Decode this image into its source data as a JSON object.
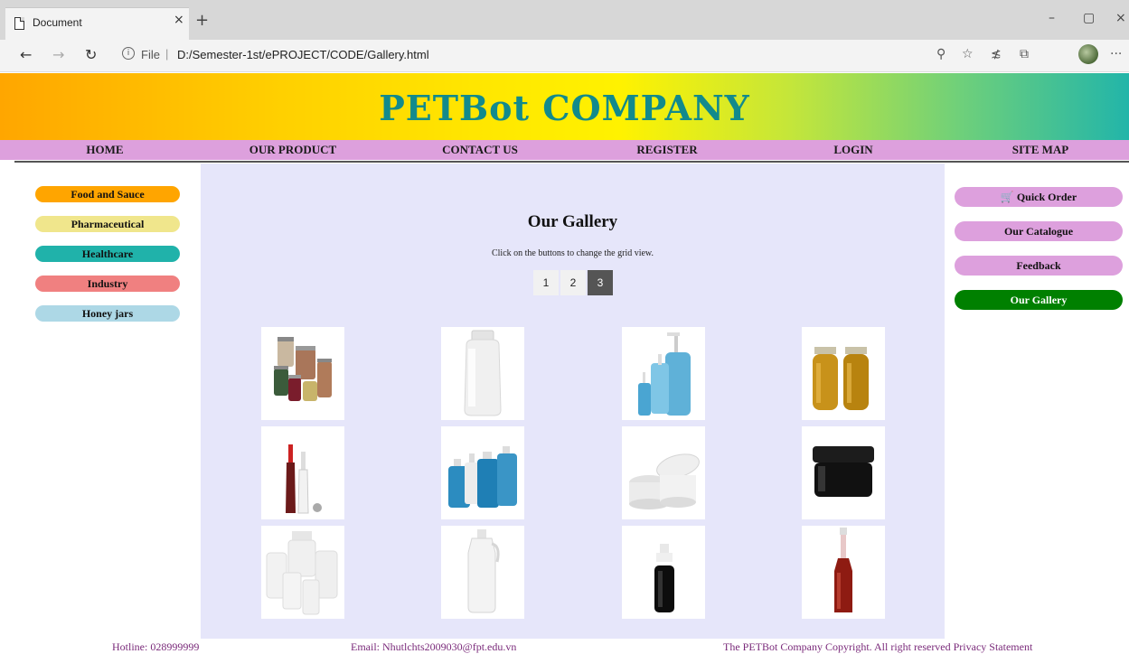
{
  "browser": {
    "tab_title": "Document",
    "tab_close": "×",
    "new_tab": "+",
    "window_controls": {
      "minimize": "–",
      "restore": "▢",
      "close": "×"
    },
    "nav": {
      "back": "←",
      "forward": "→",
      "refresh": "↻"
    },
    "address": {
      "scheme_label": "File",
      "separator": "|",
      "url": "D:/Semester-1st/ePROJECT/CODE/Gallery.html"
    },
    "toolbar_icons": [
      "zoom-icon",
      "favorite-star-icon",
      "favorites-list-icon",
      "collections-icon",
      "profile-avatar-icon",
      "more-icon"
    ]
  },
  "header": {
    "company_name": "PETBot COMPANY"
  },
  "menu": {
    "items": [
      {
        "label": "HOME"
      },
      {
        "label": "OUR PRODUCT"
      },
      {
        "label": "CONTACT US"
      },
      {
        "label": "REGISTER"
      },
      {
        "label": "LOGIN"
      },
      {
        "label": "SITE MAP"
      }
    ]
  },
  "left_sidebar": {
    "categories": [
      {
        "label": "Food and Sauce",
        "color": "#ffa500"
      },
      {
        "label": "Pharmaceutical",
        "color": "#f0e68c"
      },
      {
        "label": "Healthcare",
        "color": "#20b2aa"
      },
      {
        "label": "Industry",
        "color": "#f08080"
      },
      {
        "label": "Honey jars",
        "color": "#add8e6"
      }
    ]
  },
  "gallery": {
    "title": "Our Gallery",
    "instruction": "Click on the buttons to change the grid view.",
    "grid_buttons": [
      {
        "label": "1"
      },
      {
        "label": "2"
      },
      {
        "label": "3",
        "active": true
      }
    ],
    "images": [
      "mixed-jars-image",
      "white-bottle-image",
      "blue-pump-bottles-image",
      "honey-jars-image",
      "sauce-bottles-image",
      "blue-jugs-image",
      "white-cream-jars-image",
      "black-jar-image",
      "white-pill-bottles-image",
      "white-handle-jug-image",
      "black-spray-bottle-image",
      "red-sauce-bottle-image"
    ]
  },
  "right_sidebar": {
    "items": [
      {
        "label": "Quick Order",
        "icon": "cart-icon",
        "color": "#dda0dd",
        "text_color": "#111111"
      },
      {
        "label": "Our Catalogue",
        "color": "#dda0dd",
        "text_color": "#111111"
      },
      {
        "label": "Feedback",
        "color": "#dda0dd",
        "text_color": "#111111"
      },
      {
        "label": "Our Gallery",
        "color": "#008000",
        "text_color": "#ffffff",
        "active": true
      }
    ]
  },
  "footer": {
    "hotline": "Hotline: 028999999",
    "email": "Email: Nhutlchts2009030@fpt.edu.vn",
    "copyright": "The PETBot Company Copyright. All right reserved Privacy Statement"
  }
}
